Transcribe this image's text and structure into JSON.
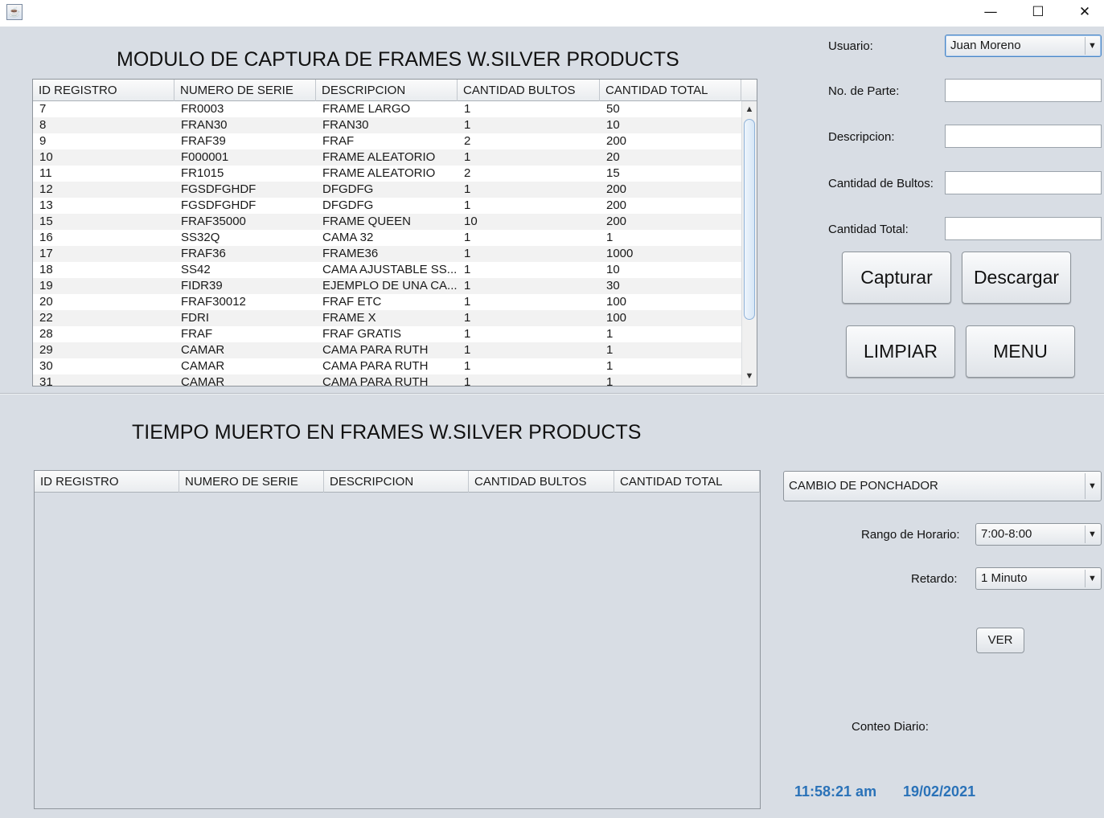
{
  "window": {
    "minimize_glyph": "—",
    "maximize_glyph": "☐",
    "close_glyph": "✕",
    "app_icon": "java-icon"
  },
  "capture": {
    "title": "MODULO DE CAPTURA DE FRAMES W.SILVER PRODUCTS",
    "columns": [
      "ID REGISTRO",
      "NUMERO DE SERIE",
      "DESCRIPCION",
      "CANTIDAD BULTOS",
      "CANTIDAD TOTAL"
    ],
    "rows": [
      [
        "7",
        "FR0003",
        "FRAME LARGO",
        "1",
        "50"
      ],
      [
        "8",
        "FRAN30",
        "FRAN30",
        "1",
        "10"
      ],
      [
        "9",
        "FRAF39",
        "FRAF",
        "2",
        "200"
      ],
      [
        "10",
        "F000001",
        "FRAME ALEATORIO",
        "1",
        "20"
      ],
      [
        "11",
        "FR1015",
        "FRAME ALEATORIO",
        "2",
        "15"
      ],
      [
        "12",
        "FGSDFGHDF",
        "DFGDFG",
        "1",
        "200"
      ],
      [
        "13",
        "FGSDFGHDF",
        "DFGDFG",
        "1",
        "200"
      ],
      [
        "15",
        "FRAF35000",
        "FRAME QUEEN",
        "10",
        "200"
      ],
      [
        "16",
        "SS32Q",
        "CAMA 32",
        "1",
        "1"
      ],
      [
        "17",
        "FRAF36",
        "FRAME36",
        "1",
        "1000"
      ],
      [
        "18",
        "SS42",
        "CAMA AJUSTABLE SS...",
        "1",
        "10"
      ],
      [
        "19",
        "FIDR39",
        "EJEMPLO DE UNA CA...",
        "1",
        "30"
      ],
      [
        "20",
        "FRAF30012",
        "FRAF ETC",
        "1",
        "100"
      ],
      [
        "22",
        "FDRI",
        "FRAME X",
        "1",
        "100"
      ],
      [
        "28",
        "FRAF",
        "FRAF GRATIS",
        "1",
        "1"
      ],
      [
        "29",
        "CAMAR",
        "CAMA PARA RUTH",
        "1",
        "1"
      ],
      [
        "30",
        "CAMAR",
        "CAMA PARA RUTH",
        "1",
        "1"
      ],
      [
        "31",
        "CAMAR",
        "CAMA PARA RUTH",
        "1",
        "1"
      ]
    ],
    "scroll_up": "▲",
    "scroll_down": "▼"
  },
  "form": {
    "usuario_label": "Usuario:",
    "usuario_value": "Juan Moreno",
    "parte_label": "No. de Parte:",
    "parte_value": "",
    "descripcion_label": "Descripcion:",
    "descripcion_value": "",
    "bultos_label": "Cantidad de Bultos:",
    "bultos_value": "",
    "total_label": "Cantidad Total:",
    "total_value": "",
    "capturar": "Capturar",
    "descargar": "Descargar",
    "limpiar": "LIMPIAR",
    "menu": "MENU"
  },
  "downtime": {
    "title": "TIEMPO MUERTO EN FRAMES W.SILVER PRODUCTS",
    "columns": [
      "ID REGISTRO",
      "NUMERO DE SERIE",
      "DESCRIPCION",
      "CANTIDAD BULTOS",
      "CANTIDAD TOTAL"
    ],
    "rows": []
  },
  "filters": {
    "reason_value": "CAMBIO DE PONCHADOR",
    "rango_label": "Rango de Horario:",
    "rango_value": "7:00-8:00",
    "retardo_label": "Retardo:",
    "retardo_value": "1 Minuto",
    "ver": "VER",
    "conteo_label": "Conteo Diario:",
    "dropdown_arrow": "▼"
  },
  "clock": {
    "time": "11:58:21 am",
    "date": "19/02/2021"
  },
  "colors": {
    "clock": "#2a72b8",
    "background": "#d8dde4"
  }
}
